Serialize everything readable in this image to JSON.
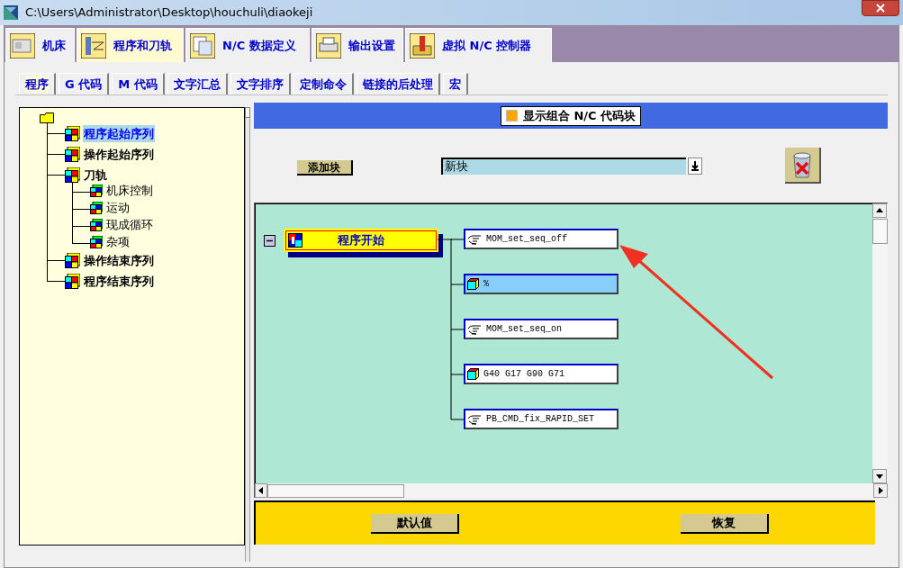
{
  "window": {
    "title": "C:\\Users\\Administrator\\Desktop\\houchuli\\diaokeji"
  },
  "main_tabs": [
    {
      "label": "机床",
      "selected": false
    },
    {
      "label": "程序和刀轨",
      "selected": true
    },
    {
      "label": "N/C 数据定义",
      "selected": false
    },
    {
      "label": "输出设置",
      "selected": false
    },
    {
      "label": "虚拟 N/C 控制器",
      "selected": false
    }
  ],
  "sub_tabs": [
    {
      "label": "程序",
      "selected": true
    },
    {
      "label": "G 代码",
      "selected": false
    },
    {
      "label": "M 代码",
      "selected": false
    },
    {
      "label": "文字汇总",
      "selected": false
    },
    {
      "label": "文字排序",
      "selected": false
    },
    {
      "label": "定制命令",
      "selected": false
    },
    {
      "label": "链接的后处理",
      "selected": false
    },
    {
      "label": "宏",
      "selected": false
    }
  ],
  "tree": {
    "children": [
      {
        "label": "程序起始序列",
        "selected": true
      },
      {
        "label": "操作起始序列",
        "selected": false
      },
      {
        "label": "刀轨",
        "selected": false,
        "children": [
          {
            "label": "机床控制",
            "selected": false
          },
          {
            "label": "运动",
            "selected": false
          },
          {
            "label": "现成循环",
            "selected": false
          },
          {
            "label": "杂项",
            "selected": false
          }
        ]
      },
      {
        "label": "操作结束序列",
        "selected": false
      },
      {
        "label": "程序结束序列",
        "selected": false
      }
    ]
  },
  "display_toggle": {
    "label": "显示组合 N/C 代码块"
  },
  "add_block_button": "添加块",
  "block_select": {
    "value": "新块"
  },
  "sequence": {
    "label": "程序开始",
    "expanded": true,
    "blocks": [
      {
        "kind": "command",
        "text": "MOM_set_seq_off",
        "selected": false
      },
      {
        "kind": "block",
        "text": "%",
        "selected": true
      },
      {
        "kind": "command",
        "text": "MOM_set_seq_on",
        "selected": false
      },
      {
        "kind": "block",
        "text": "G40 G17 G90 G71",
        "selected": false
      },
      {
        "kind": "command",
        "text": "PB_CMD_fix_RAPID_SET",
        "selected": false
      }
    ]
  },
  "buttons": [
    "默认值",
    "恢复"
  ]
}
